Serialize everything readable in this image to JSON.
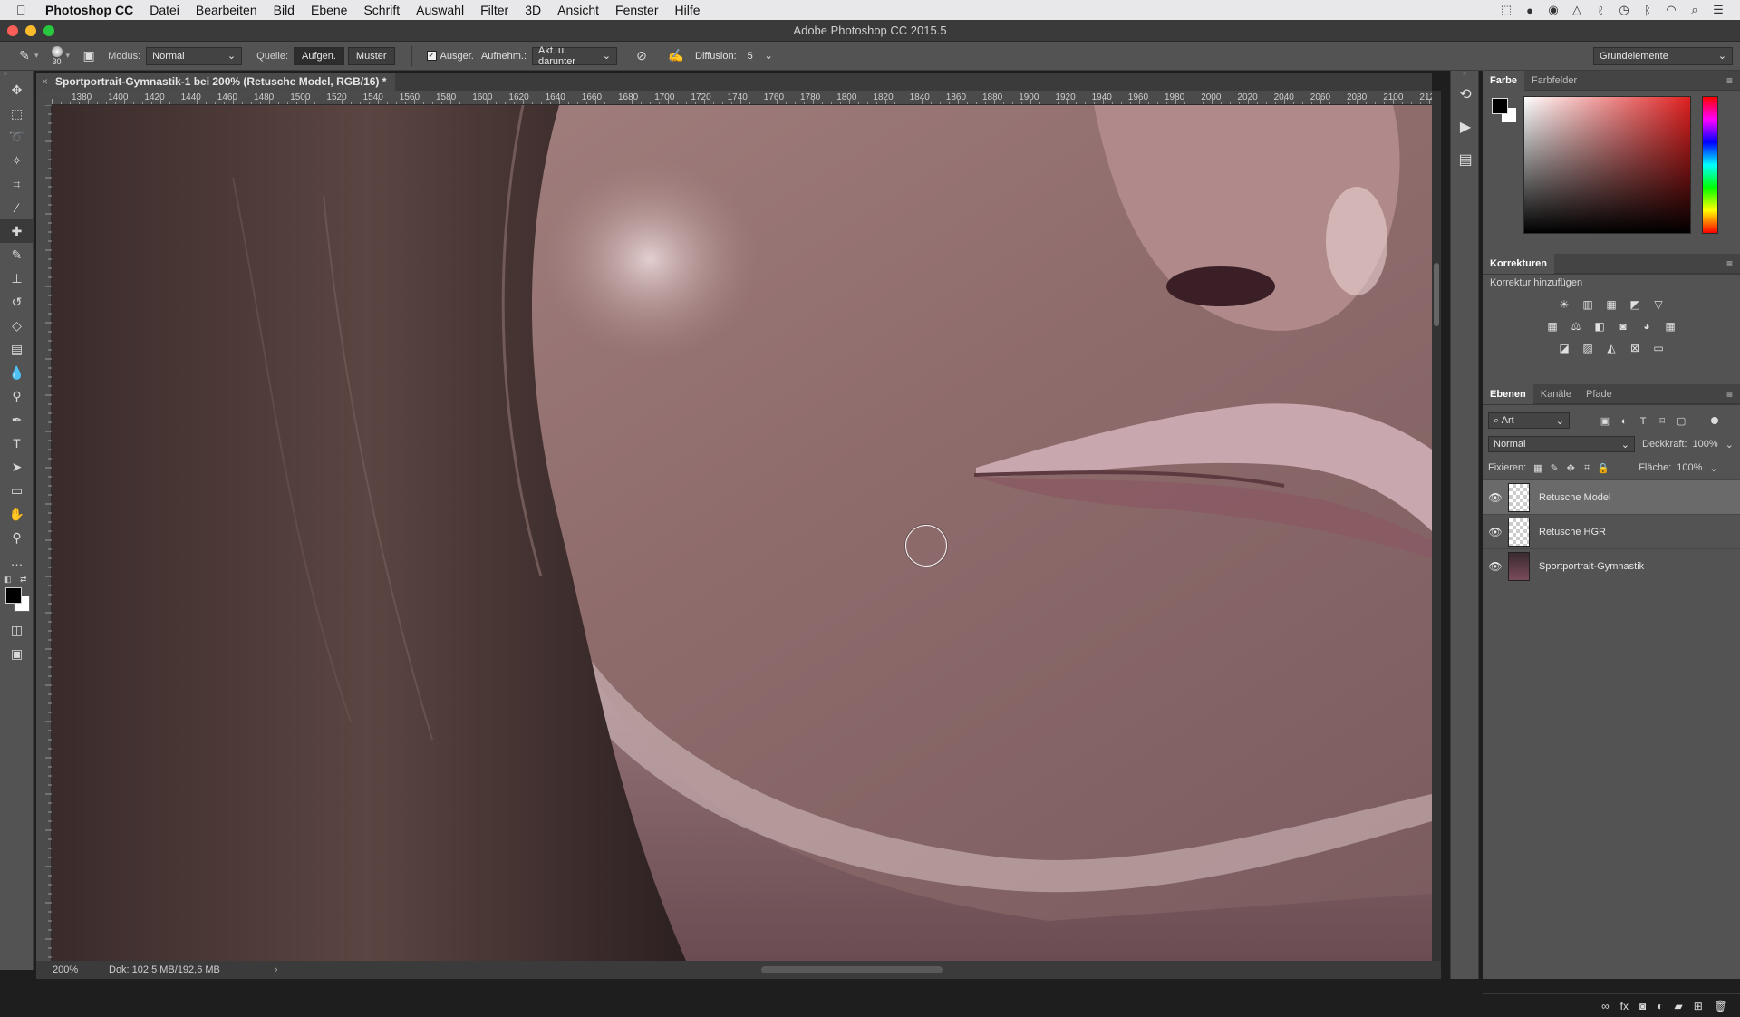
{
  "menubar": {
    "app_name": "Photoshop CC",
    "items": [
      "Datei",
      "Bearbeiten",
      "Bild",
      "Ebene",
      "Schrift",
      "Auswahl",
      "Filter",
      "3D",
      "Ansicht",
      "Fenster",
      "Hilfe"
    ]
  },
  "window": {
    "title": "Adobe Photoshop CC 2015.5"
  },
  "options": {
    "brush_size": "30",
    "modus_label": "Modus:",
    "modus_value": "Normal",
    "quelle_label": "Quelle:",
    "aufgen_button": "Aufgen.",
    "muster_button": "Muster",
    "ausger_label": "Ausger.",
    "aufnehm_label": "Aufnehm.:",
    "aufnehm_value": "Akt. u. darunter",
    "diffusion_label": "Diffusion:",
    "diffusion_value": "5",
    "workspace": "Grundelemente"
  },
  "document": {
    "tab_title": "Sportportrait-Gymnastik-1 bei 200% (Retusche Model, RGB/16) *",
    "close_glyph": "×"
  },
  "ruler": {
    "ticks": [
      "1380",
      "1400",
      "1420",
      "1440",
      "1460",
      "1480",
      "1500",
      "1520",
      "1540",
      "1560",
      "1580",
      "1600",
      "1620",
      "1640",
      "1660",
      "1680",
      "1700",
      "1720",
      "1740",
      "1760",
      "1780",
      "1800",
      "1820",
      "1840",
      "1860",
      "1880",
      "1900",
      "1920",
      "1940",
      "1960",
      "1980",
      "2000",
      "2020",
      "2040",
      "2060",
      "2080",
      "2100",
      "212"
    ]
  },
  "status": {
    "zoom": "200%",
    "doc_info": "Dok: 102,5 MB/192,6 MB",
    "arrow": "›"
  },
  "color_panel": {
    "tabs": [
      "Farbe",
      "Farbfelder"
    ],
    "foreground": "#000000",
    "background": "#ffffff"
  },
  "adjustments": {
    "title": "Korrekturen",
    "subtitle": "Korrektur hinzufügen"
  },
  "layers_panel": {
    "tabs": [
      "Ebenen",
      "Kanäle",
      "Pfade"
    ],
    "filter_value": "Art",
    "blend_mode": "Normal",
    "opacity_label": "Deckkraft:",
    "opacity_value": "100%",
    "lock_label": "Fixieren:",
    "fill_label": "Fläche:",
    "fill_value": "100%",
    "layers": [
      {
        "name": "Retusche Model",
        "selected": true
      },
      {
        "name": "Retusche HGR",
        "selected": false
      },
      {
        "name": "Sportportrait-Gymnastik",
        "selected": false
      }
    ]
  },
  "colors": {
    "ui_dark": "#535353",
    "accent_red_close": "#fc5f57",
    "accent_yellow_min": "#fdbc2e",
    "accent_green_max": "#28c840"
  }
}
